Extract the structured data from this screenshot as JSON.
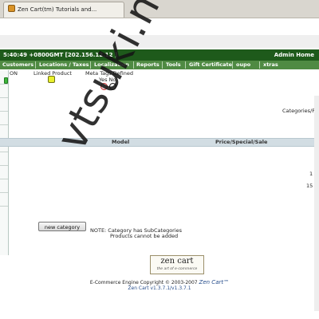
{
  "browser": {
    "tab_title": "Zen Cart(tm) Tutorials and..."
  },
  "header": {
    "datetime": "5:40:49 +0800GMT [202.156.12.12 ]",
    "admin_home": "Admin Home"
  },
  "menu": {
    "items": [
      "Customers",
      "Locations / Taxes",
      "Localization",
      "Reports",
      "Tools",
      "Gift Certificate",
      "oupo",
      "xtras"
    ]
  },
  "listing": {
    "status_label": "ON",
    "linked_product_label": "Linked Product",
    "meta_tags_label": "Meta Tags Defined",
    "meta_yes_no": "Yes No",
    "categories_products_label": "Categories/Proc",
    "columns": [
      "Model",
      "Price/Special/Sale"
    ],
    "right_values": [
      "1",
      "15"
    ]
  },
  "buttons": {
    "new_category": "new category"
  },
  "note": {
    "line1": "NOTE: Category has SubCategories",
    "line2": "Products cannot be added"
  },
  "logo": {
    "word": "zen cart",
    "tagline": "the art of e-commerce"
  },
  "footer": {
    "copyright": "E-Commerce Engine Copyright © 2003-2007",
    "brand": "Zen Cart™",
    "version": "Zen Cart v1.3.7.1/v1.3.7.1"
  },
  "watermark": "vtsuki.net",
  "colors": {
    "header_bg": "#1e5a1b",
    "menu_bg": "#4f8a43",
    "table_head_bg": "#d2dde3",
    "indicator_green": "#3db63b",
    "indicator_yellow": "#e9f02c"
  }
}
